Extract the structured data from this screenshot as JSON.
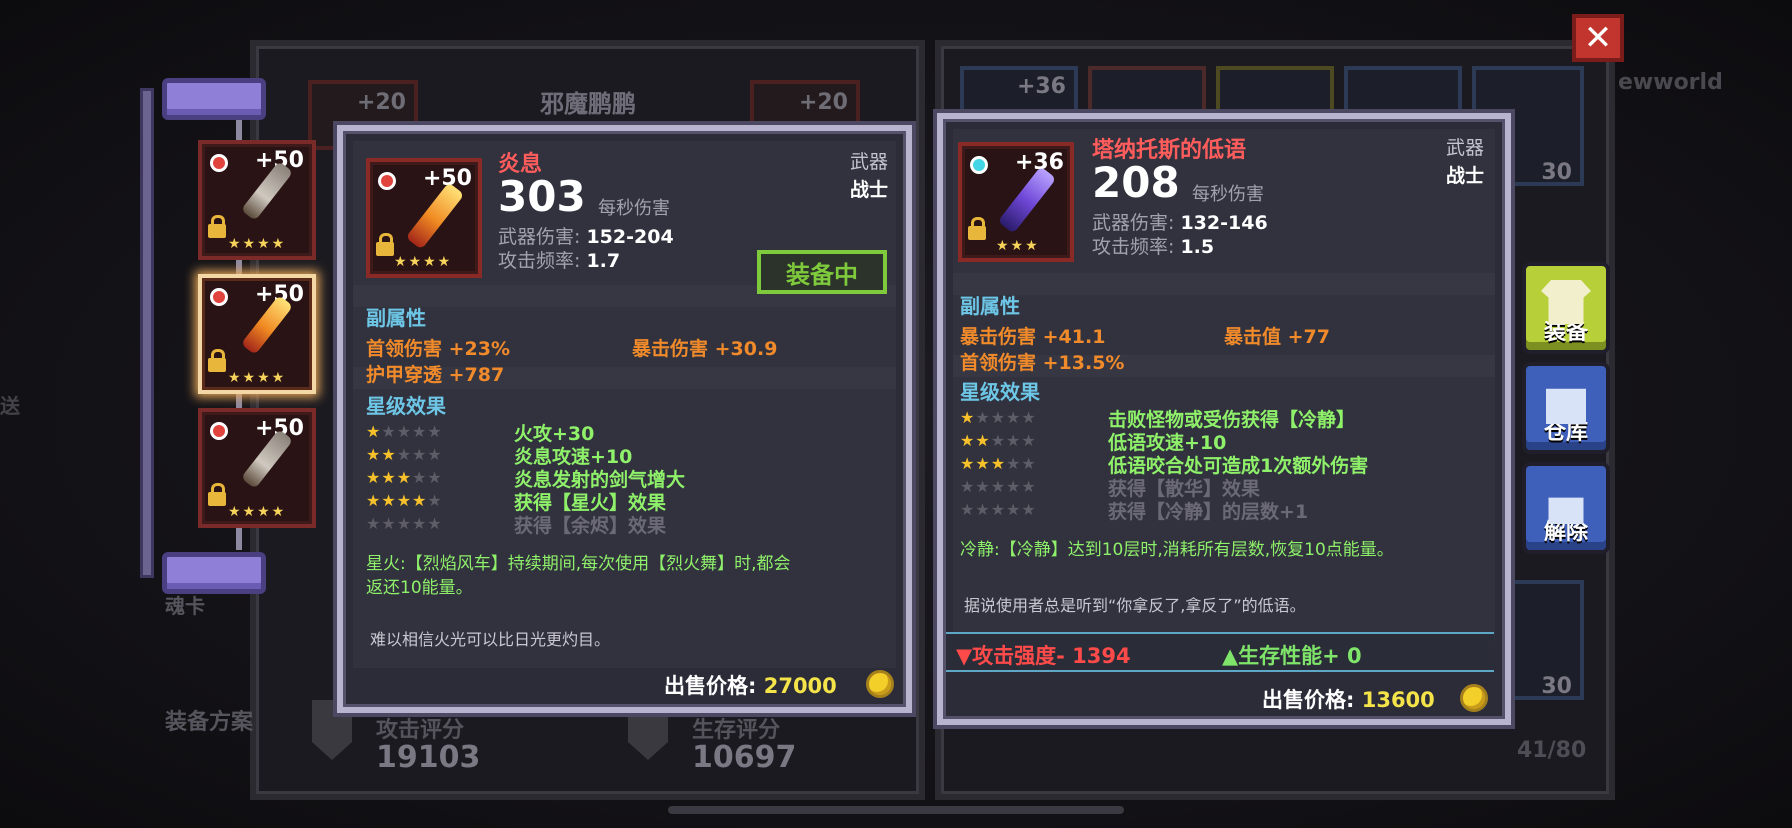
{
  "background": {
    "title": "邪魔鹏鹏",
    "left_slot_levels": [
      "+20",
      "+20"
    ],
    "stats": [
      {
        "label": "攻击评分",
        "value": "19103"
      },
      {
        "label": "生存评分",
        "value": "10697"
      }
    ],
    "right_slot_levels": [
      "+36",
      "30",
      "30"
    ],
    "inventory_count": "41/80",
    "plan_label": "装备方案",
    "down_label": "魂卡",
    "send_label": "送",
    "newworld_label": "ewworld"
  },
  "close_label": "✕",
  "item_list": [
    {
      "level": "+50",
      "stars": "★★★★",
      "type": "silver"
    },
    {
      "level": "+50",
      "stars": "★★★★",
      "type": "fire"
    },
    {
      "level": "+50",
      "stars": "★★★★",
      "type": "silver"
    }
  ],
  "left_item": {
    "name": "炎息",
    "level": "+50",
    "icon_stars": "★★★★",
    "dps": "303",
    "dps_label": "每秒伤害",
    "weapon_damage_label": "武器伤害:",
    "weapon_damage": "152-204",
    "attack_rate_label": "攻击频率:",
    "attack_rate": "1.7",
    "category": "武器",
    "class": "战士",
    "equipped_label": "装备中",
    "sub_attr_title": "副属性",
    "sub_attrs": [
      "首领伤害 +23%",
      "暴击伤害 +30.9",
      "护甲穿透 +787"
    ],
    "star_title": "星级效果",
    "star_effects": [
      {
        "on": 1,
        "text": "火攻+30",
        "active": true
      },
      {
        "on": 2,
        "text": "炎息攻速+10",
        "active": true
      },
      {
        "on": 3,
        "text": "炎息发射的剑气增大",
        "active": true
      },
      {
        "on": 4,
        "text": "获得【星火】效果",
        "active": true
      },
      {
        "on": 5,
        "text": "获得【余烬】效果",
        "active": false
      }
    ],
    "desc_line1": "星火:【烈焰风车】持续期间,每次使用【烈火舞】时,都会",
    "desc_line2": "返还10能量。",
    "flavor": "难以相信火光可以比日光更灼目。",
    "sell_label": "出售价格:",
    "sell_price": "27000"
  },
  "right_item": {
    "name": "塔纳托斯的低语",
    "level": "+36",
    "icon_stars": "★★★",
    "dps": "208",
    "dps_label": "每秒伤害",
    "weapon_damage_label": "武器伤害:",
    "weapon_damage": "132-146",
    "attack_rate_label": "攻击频率:",
    "attack_rate": "1.5",
    "category": "武器",
    "class": "战士",
    "sub_attr_title": "副属性",
    "sub_attrs": [
      "暴击伤害 +41.1",
      "暴击值 +77",
      "首领伤害 +13.5%"
    ],
    "star_title": "星级效果",
    "star_effects": [
      {
        "on": 1,
        "text": "击败怪物或受伤获得【冷静】",
        "active": true
      },
      {
        "on": 2,
        "text": "低语攻速+10",
        "active": true
      },
      {
        "on": 3,
        "text": "低语咬合处可造成1次额外伤害",
        "active": true
      },
      {
        "on": 4,
        "text": "获得【散华】效果",
        "active": false
      },
      {
        "on": 5,
        "text": "获得【冷静】的层数+1",
        "active": false
      }
    ],
    "desc": "冷静:【冷静】达到10层时,消耗所有层数,恢复10点能量。",
    "flavor": "据说使用者总是听到“你拿反了,拿反了”的低语。",
    "compare_down": "▼攻击强度- 1394",
    "compare_up": "▲生存性能+ 0",
    "sell_label": "出售价格:",
    "sell_price": "13600"
  },
  "side_buttons": [
    "装备",
    "仓库",
    "解除"
  ]
}
